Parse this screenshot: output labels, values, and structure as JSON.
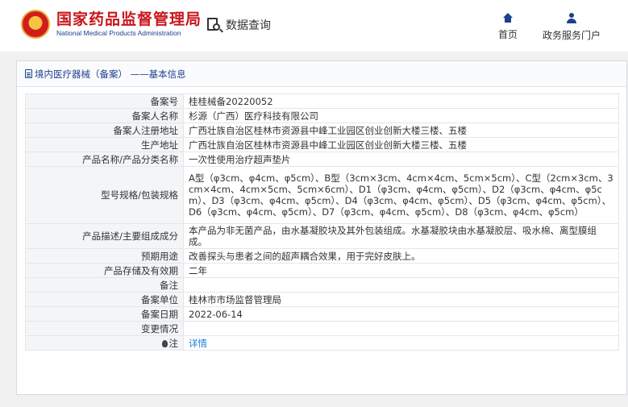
{
  "header": {
    "logo_cn": "国家药品监督管理局",
    "logo_en": "National Medical Products Administration",
    "query_label": "数据查询",
    "nav": [
      {
        "label": "首页",
        "icon": "home-icon"
      },
      {
        "label": "政务服务门户",
        "icon": "user-icon"
      }
    ]
  },
  "panel": {
    "breadcrumb": "境内医疗器械（备案） ——基本信息",
    "rows": [
      {
        "label": "备案号",
        "value": "桂桂械备20220052"
      },
      {
        "label": "备案人名称",
        "value": "杉源（广西）医疗科技有限公司"
      },
      {
        "label": "备案人注册地址",
        "value": "广西壮族自治区桂林市资源县中峰工业园区创业创新大楼三楼、五楼"
      },
      {
        "label": "生产地址",
        "value": "广西壮族自治区桂林市资源县中峰工业园区创业创新大楼三楼、五楼"
      },
      {
        "label": "产品名称/产品分类名称",
        "value": "一次性使用治疗超声垫片"
      },
      {
        "label": "型号规格/包装规格",
        "value": "A型（φ3cm、φ4cm、φ5cm）、B型（3cm×3cm、4cm×4cm、5cm×5cm）、C型（2cm×3cm、3cm×4cm、4cm×5cm、5cm×6cm）、D1（φ3cm、φ4cm、φ5cm）、D2（φ3cm、φ4cm、φ5cm）、D3（φ3cm、φ4cm、φ5cm）、D4（φ3cm、φ4cm、φ5cm）、D5（φ3cm、φ4cm、φ5cm）、D6（φ3cm、φ4cm、φ5cm）、D7（φ3cm、φ4cm、φ5cm）、D8（φ3cm、φ4cm、φ5cm）"
      },
      {
        "label": "产品描述/主要组成成分",
        "value": "本产品为非无菌产品，由水基凝胶块及其外包装组成。水基凝胶块由水基凝胶层、吸水棉、离型膜组成。"
      },
      {
        "label": "预期用途",
        "value": "改善探头与患者之间的超声耦合效果，用于完好皮肤上。"
      },
      {
        "label": "产品存储及有效期",
        "value": "二年"
      },
      {
        "label": "备注",
        "value": ""
      },
      {
        "label": "备案单位",
        "value": "桂林市市场监督管理局"
      },
      {
        "label": "备案日期",
        "value": "2022-06-14"
      },
      {
        "label": "变更情况",
        "value": ""
      }
    ],
    "note_label": "注",
    "note_link": "详情"
  }
}
